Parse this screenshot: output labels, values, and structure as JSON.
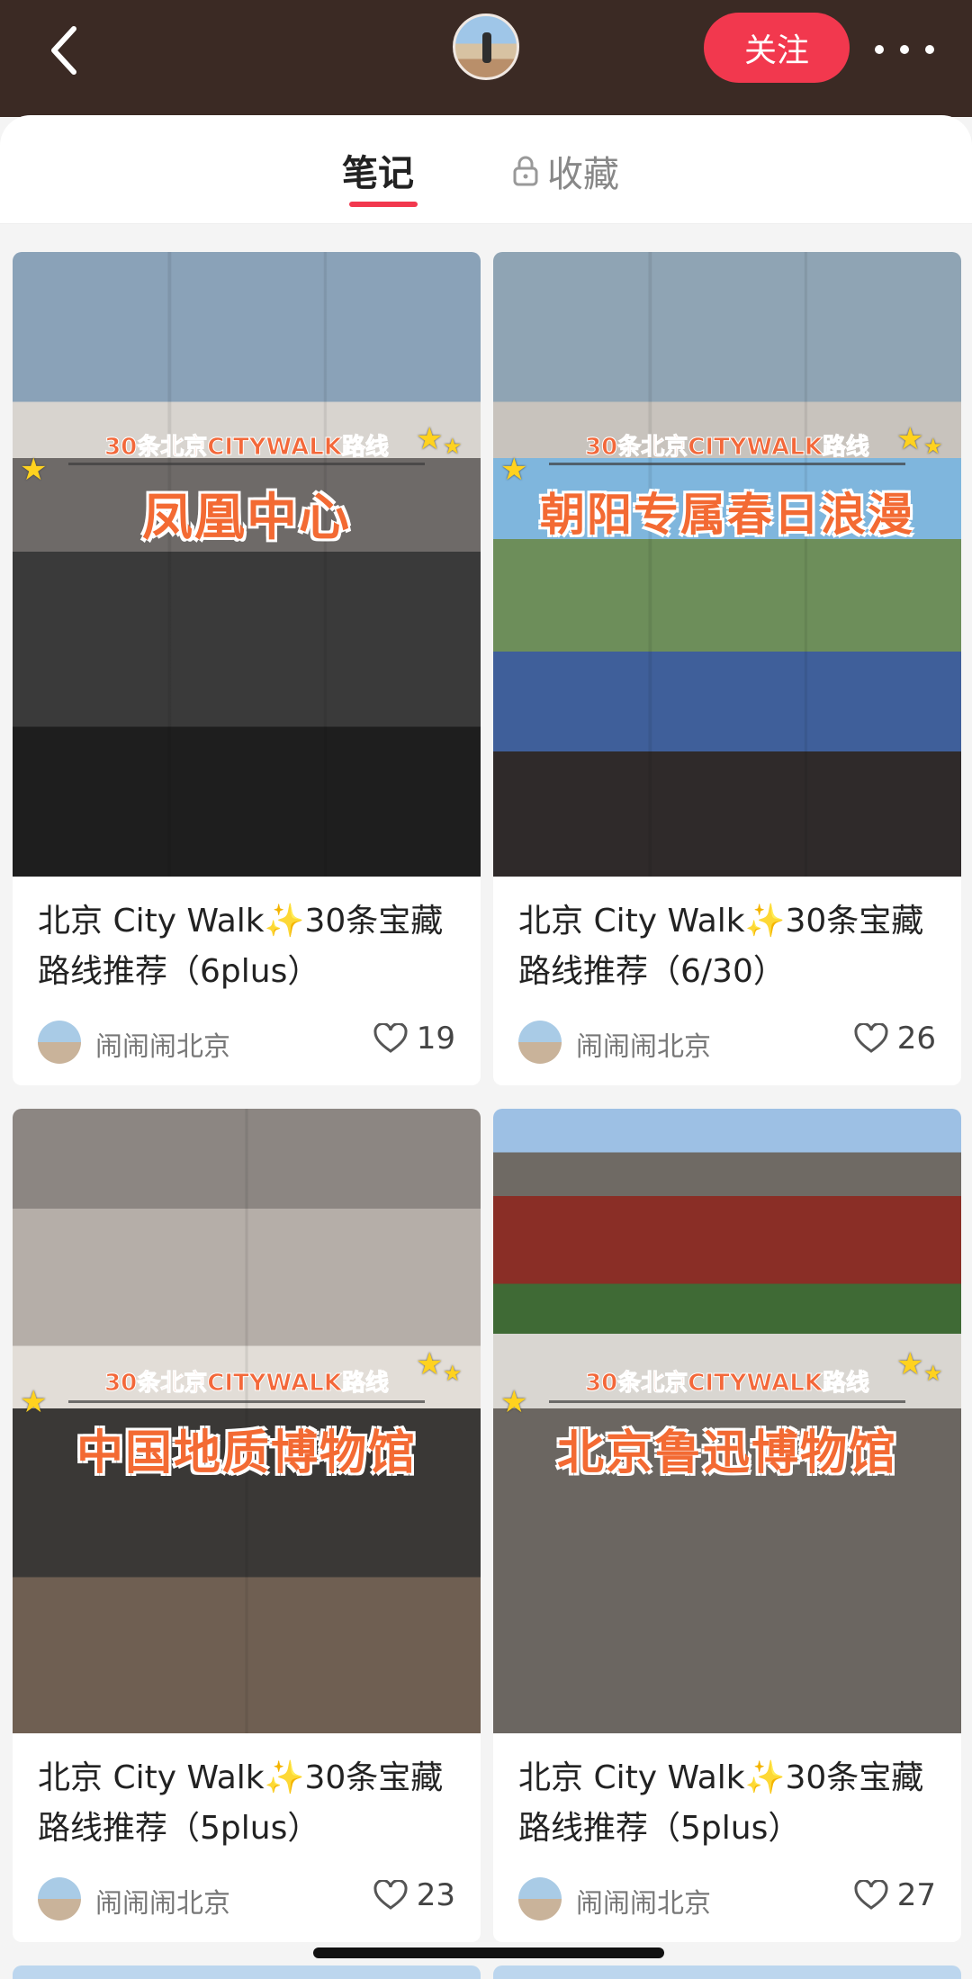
{
  "header": {
    "follow_label": "关注",
    "colors": {
      "bar": "#3b2a24",
      "accent": "#f2384e"
    }
  },
  "tabs": [
    {
      "label": "笔记",
      "active": true
    },
    {
      "label": "收藏",
      "active": false,
      "icon": "lock-icon"
    }
  ],
  "cards": [
    {
      "banner_sub": "30条北京CITYWALK路线",
      "banner_main": "凤凰中心",
      "title": "北京 City Walk✨30条宝藏路线推荐（6plus）",
      "author": "闹闹闹北京",
      "likes": "19"
    },
    {
      "banner_sub": "30条北京CITYWALK路线",
      "banner_main": "朝阳专属春日浪漫",
      "title": "北京 City Walk✨30条宝藏路线推荐（6/30）",
      "author": "闹闹闹北京",
      "likes": "26"
    },
    {
      "banner_sub": "30条北京CITYWALK路线",
      "banner_main": "中国地质博物馆",
      "title": "北京 City Walk✨30条宝藏路线推荐（5plus）",
      "author": "闹闹闹北京",
      "likes": "23"
    },
    {
      "banner_sub": "30条北京CITYWALK路线",
      "banner_main": "北京鲁迅博物馆",
      "title": "北京 City Walk✨30条宝藏路线推荐（5plus）",
      "author": "闹闹闹北京",
      "likes": "27"
    }
  ]
}
